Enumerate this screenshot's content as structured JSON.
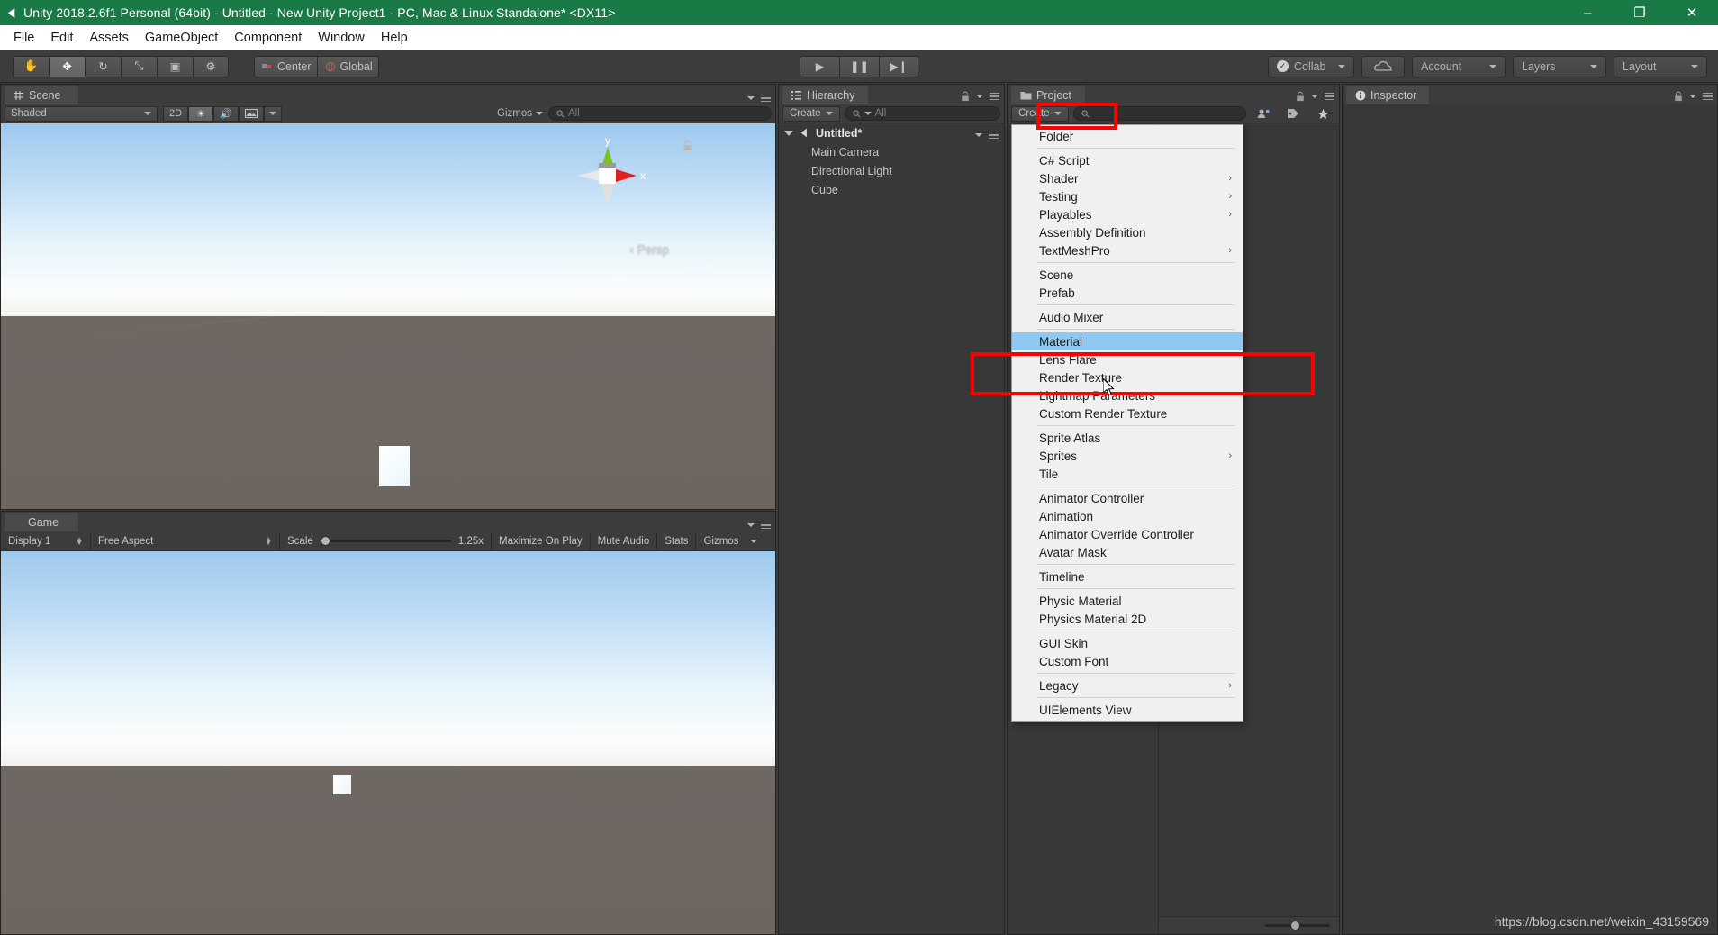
{
  "window": {
    "title": "Unity 2018.2.6f1 Personal (64bit) - Untitled - New Unity Project1 - PC, Mac & Linux Standalone* <DX11>",
    "logo_icon": "unity-logo-icon",
    "minimize_label": "–",
    "maximize_label": "❐",
    "close_label": "✕"
  },
  "menubar": {
    "items": [
      {
        "label": "File"
      },
      {
        "label": "Edit"
      },
      {
        "label": "Assets"
      },
      {
        "label": "GameObject"
      },
      {
        "label": "Component"
      },
      {
        "label": "Window"
      },
      {
        "label": "Help"
      }
    ]
  },
  "toolbar": {
    "tools": [
      {
        "name": "hand-tool",
        "icon": "✋",
        "active": false
      },
      {
        "name": "move-tool",
        "icon": "✥",
        "active": true
      },
      {
        "name": "rotate-tool",
        "icon": "↻",
        "active": false
      },
      {
        "name": "scale-tool",
        "icon": "⤡",
        "active": false
      },
      {
        "name": "rect-tool",
        "icon": "▣",
        "active": false
      },
      {
        "name": "transform-tool",
        "icon": "⚙",
        "active": false
      }
    ],
    "pivot_mode": "Center",
    "pivot_rotation": "Global",
    "play": "▶",
    "pause": "❚❚",
    "step": "▶❙",
    "collab": "Collab",
    "cloud_icon": "cloud-icon",
    "account": "Account",
    "layers": "Layers",
    "layout": "Layout"
  },
  "scene": {
    "tab_label": "Scene",
    "tab_icon": "scene-grid-icon",
    "shading_mode": "Shaded",
    "toggle_2d": "2D",
    "lighting_icon": "☀",
    "audio_icon": "🔊",
    "effects_icon": "☁",
    "gizmos_label": "Gizmos",
    "search_placeholder": "All",
    "projection": "Persp",
    "axis_y": "y",
    "axis_x": "x"
  },
  "game": {
    "tab_label": "Game",
    "tab_icon": "game-pad-icon",
    "display": "Display 1",
    "aspect": "Free Aspect",
    "scale_label": "Scale",
    "scale_value": "1.25x",
    "maximize_on_play": "Maximize On Play",
    "mute_audio": "Mute Audio",
    "stats": "Stats",
    "gizmos": "Gizmos"
  },
  "hierarchy": {
    "tab_label": "Hierarchy",
    "tab_icon": "hierarchy-icon",
    "create_label": "Create",
    "search_placeholder": "All",
    "scene_name": "Untitled*",
    "objects": [
      {
        "label": "Main Camera"
      },
      {
        "label": "Directional Light"
      },
      {
        "label": "Cube"
      }
    ]
  },
  "project": {
    "tab_label": "Project",
    "tab_icon": "folder-icon",
    "create_label": "Create",
    "search_placeholder": "",
    "filter_type_icon": "type-filter-icon",
    "filter_label_icon": "label-filter-icon",
    "favorite_icon": "star-icon"
  },
  "inspector": {
    "tab_label": "Inspector",
    "tab_icon": "info-icon"
  },
  "create_menu": {
    "items": [
      {
        "label": "Folder",
        "submenu": false,
        "selected": false
      },
      {
        "separator": true
      },
      {
        "label": "C# Script",
        "submenu": false,
        "selected": false
      },
      {
        "label": "Shader",
        "submenu": true,
        "selected": false
      },
      {
        "label": "Testing",
        "submenu": true,
        "selected": false
      },
      {
        "label": "Playables",
        "submenu": true,
        "selected": false
      },
      {
        "label": "Assembly Definition",
        "submenu": false,
        "selected": false
      },
      {
        "label": "TextMeshPro",
        "submenu": true,
        "selected": false
      },
      {
        "separator": true
      },
      {
        "label": "Scene",
        "submenu": false,
        "selected": false
      },
      {
        "label": "Prefab",
        "submenu": false,
        "selected": false
      },
      {
        "separator": true
      },
      {
        "label": "Audio Mixer",
        "submenu": false,
        "selected": false
      },
      {
        "separator": true
      },
      {
        "label": "Material",
        "submenu": false,
        "selected": true
      },
      {
        "label": "Lens Flare",
        "submenu": false,
        "selected": false
      },
      {
        "label": "Render Texture",
        "submenu": false,
        "selected": false
      },
      {
        "label": "Lightmap Parameters",
        "submenu": false,
        "selected": false
      },
      {
        "label": "Custom Render Texture",
        "submenu": false,
        "selected": false
      },
      {
        "separator": true
      },
      {
        "label": "Sprite Atlas",
        "submenu": false,
        "selected": false
      },
      {
        "label": "Sprites",
        "submenu": true,
        "selected": false
      },
      {
        "label": "Tile",
        "submenu": false,
        "selected": false
      },
      {
        "separator": true
      },
      {
        "label": "Animator Controller",
        "submenu": false,
        "selected": false
      },
      {
        "label": "Animation",
        "submenu": false,
        "selected": false
      },
      {
        "label": "Animator Override Controller",
        "submenu": false,
        "selected": false
      },
      {
        "label": "Avatar Mask",
        "submenu": false,
        "selected": false
      },
      {
        "separator": true
      },
      {
        "label": "Timeline",
        "submenu": false,
        "selected": false
      },
      {
        "separator": true
      },
      {
        "label": "Physic Material",
        "submenu": false,
        "selected": false
      },
      {
        "label": "Physics Material 2D",
        "submenu": false,
        "selected": false
      },
      {
        "separator": true
      },
      {
        "label": "GUI Skin",
        "submenu": false,
        "selected": false
      },
      {
        "label": "Custom Font",
        "submenu": false,
        "selected": false
      },
      {
        "separator": true
      },
      {
        "label": "Legacy",
        "submenu": true,
        "selected": false
      },
      {
        "separator": true
      },
      {
        "label": "UIElements View",
        "submenu": false,
        "selected": false
      }
    ],
    "submenu_arrow": "›"
  },
  "annotations": {
    "highlight_color": "#ff0000",
    "targets": [
      "project-create-button",
      "material-menu-item"
    ]
  },
  "watermark": "https://blog.csdn.net/weixin_43159569",
  "colors": {
    "titlebar": "#1a7a46",
    "panel_bg": "#383838",
    "toolbar_bg": "#3c3c3c",
    "menu_bg": "#f0f0f0",
    "menu_selected": "#8fc8f0",
    "annotation": "#ff0000"
  }
}
